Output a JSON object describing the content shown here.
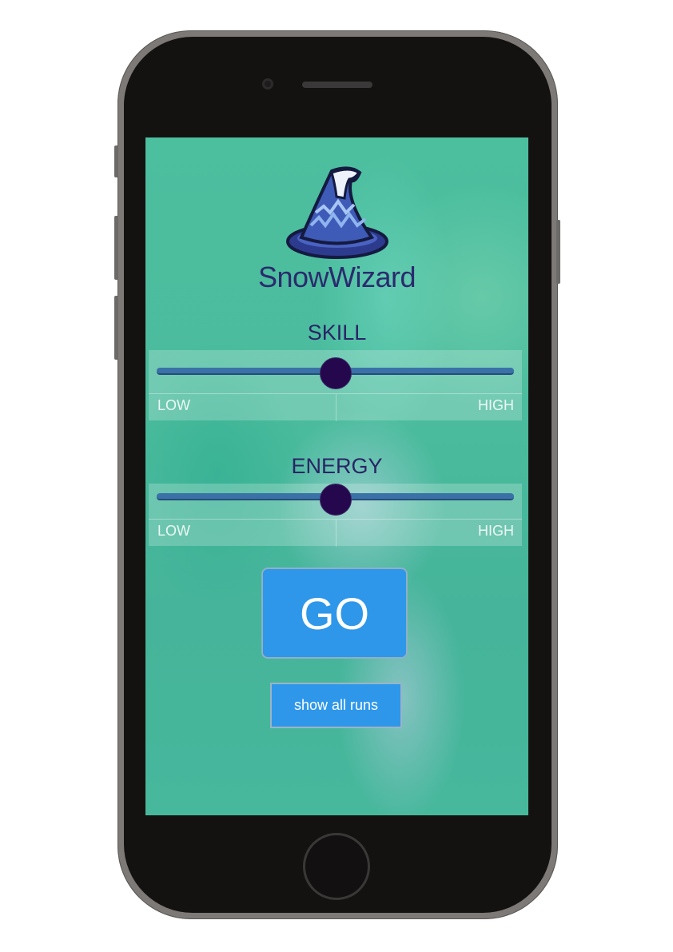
{
  "app": {
    "name": "SnowWizard",
    "logo_icon": "wizard-hat-icon"
  },
  "skill": {
    "title": "SKILL",
    "low_label": "LOW",
    "high_label": "HIGH",
    "value": 0.5
  },
  "energy": {
    "title": "ENERGY",
    "low_label": "LOW",
    "high_label": "HIGH",
    "value": 0.5
  },
  "actions": {
    "go_label": "GO",
    "show_runs_label": "show all runs"
  },
  "colors": {
    "background": "#4bbc9d",
    "title_text": "#2a2466",
    "track": "#3a72a8",
    "thumb": "#24074c",
    "button": "#2e97ea"
  }
}
